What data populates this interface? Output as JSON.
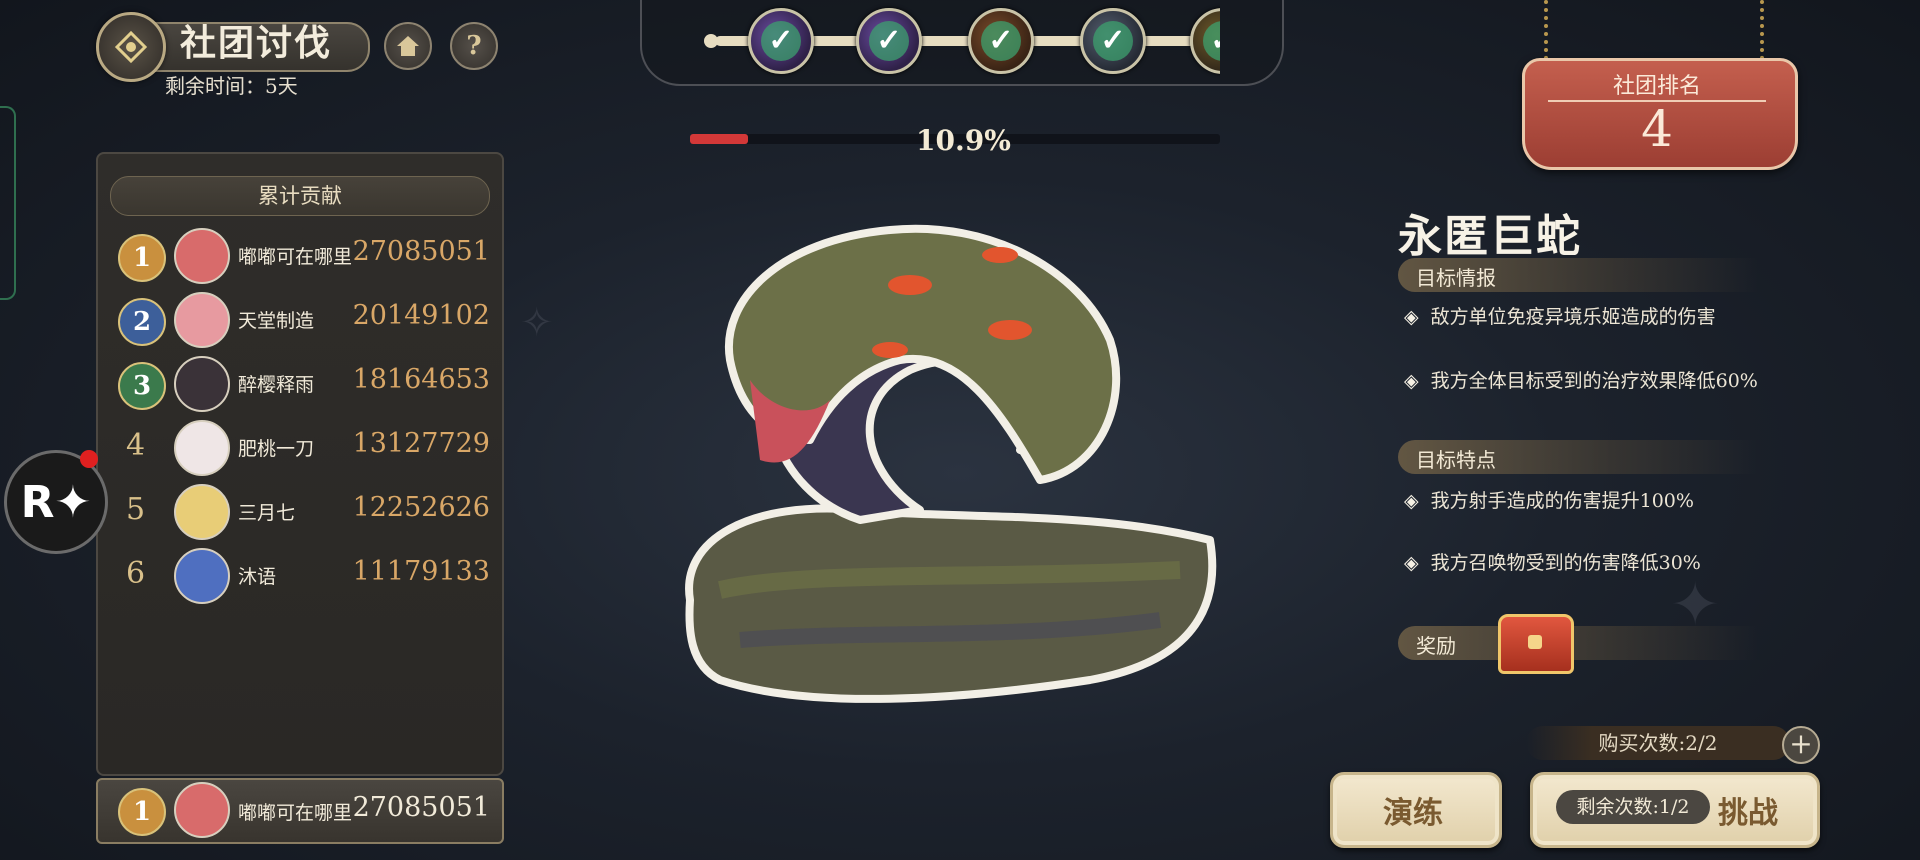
{
  "header": {
    "title": "社团讨伐",
    "time_label": "剩余时间：",
    "time_value": "5天",
    "home_icon": "home-icon",
    "help_symbol": "?"
  },
  "stages": {
    "nodes": [
      {
        "icon": "boss-portrait-1",
        "completed": true
      },
      {
        "icon": "boss-portrait-2",
        "completed": true
      },
      {
        "icon": "boss-portrait-3",
        "completed": true
      },
      {
        "icon": "boss-portrait-4",
        "completed": true
      },
      {
        "icon": "boss-portrait-5",
        "completed": true
      }
    ],
    "check_glyph": "✓"
  },
  "boss": {
    "hp_percent_text": "10.9%",
    "hp_fraction": 0.109,
    "name": "永匿巨蛇"
  },
  "contribution": {
    "header": "累计贡献",
    "rows": [
      {
        "rank": "1",
        "name": "嘟嘟可在哪里",
        "score": "27085051",
        "medal_color": "#c9903e",
        "avatar_color": "#d86b6b"
      },
      {
        "rank": "2",
        "name": "天堂制造",
        "score": "20149102",
        "medal_color": "#3d5f9a",
        "avatar_color": "#e79aa0"
      },
      {
        "rank": "3",
        "name": "醉樱释雨",
        "score": "18164653",
        "medal_color": "#3b7a4c",
        "avatar_color": "#3a3238"
      },
      {
        "rank": "4",
        "name": "肥桃一刀",
        "score": "13127729",
        "medal_color": "",
        "avatar_color": "#efe6e6"
      },
      {
        "rank": "5",
        "name": "三月七",
        "score": "12252626",
        "medal_color": "",
        "avatar_color": "#e8cd77"
      },
      {
        "rank": "6",
        "name": "沐语",
        "score": "11179133",
        "medal_color": "",
        "avatar_color": "#4f6fc0"
      }
    ],
    "self": {
      "rank": "1",
      "name": "嘟嘟可在哪里",
      "score": "27085051",
      "medal_color": "#c9903e",
      "avatar_color": "#d86b6b"
    }
  },
  "guild_rank": {
    "label": "社团排名",
    "value": "4"
  },
  "intel": {
    "title": "目标情报",
    "items": [
      "敌方单位免疫异境乐姬造成的伤害",
      "我方全体目标受到的治疗效果降低60%"
    ]
  },
  "traits": {
    "title": "目标特点",
    "items": [
      "我方射手造成的伤害提升100%",
      "我方召唤物受到的伤害降低30%"
    ]
  },
  "reward": {
    "label": "奖励",
    "icon": "treasure-chest-icon"
  },
  "actions": {
    "buy_count": "购买次数:2/2",
    "plus": "+",
    "practice": "演练",
    "remaining": "剩余次数:1/2",
    "challenge": "挑战"
  },
  "side": {
    "badge": "R✦"
  },
  "colors": {
    "accent_gold": "#d9a767",
    "hp_red": "#d33838",
    "rank_board": "#b24e40",
    "button_cream": "#efe3c6"
  }
}
